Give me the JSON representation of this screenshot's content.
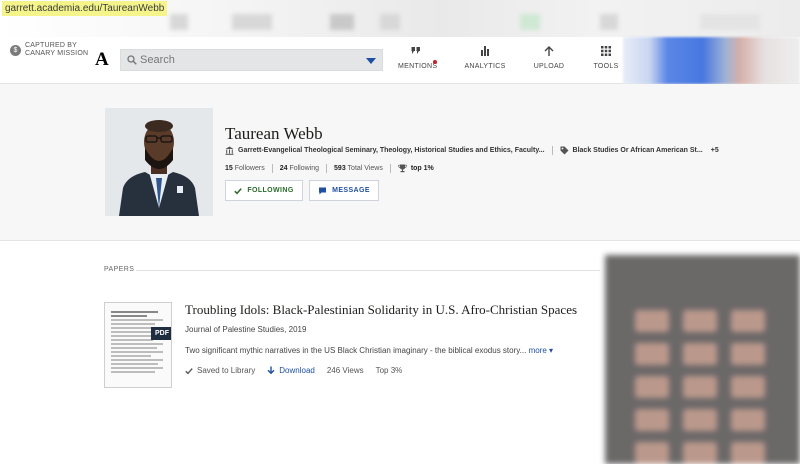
{
  "browser": {
    "url": "garrett.academia.edu/TaureanWebb"
  },
  "canary": {
    "line1": "CAPTURED BY",
    "line2": "CANARY MISSION"
  },
  "logo": {
    "text": "A"
  },
  "search": {
    "placeholder": "Search"
  },
  "nav": [
    {
      "label": "MENTIONS",
      "icon": "quote-icon"
    },
    {
      "label": "ANALYTICS",
      "icon": "bar-chart-icon"
    },
    {
      "label": "UPLOAD",
      "icon": "upload-arrow-icon"
    },
    {
      "label": "TOOLS",
      "icon": "grid-icon"
    }
  ],
  "profile": {
    "name": "Taurean Webb",
    "affiliation": "Garrett-Evangelical Theological Seminary, Theology, Historical Studies and Ethics, Faculty...",
    "interest": "Black Studies Or African American St...",
    "interest_more": "+5",
    "followers_count": "15",
    "followers_label": "Followers",
    "following_count": "24",
    "following_label": "Following",
    "views_count": "593",
    "views_label": "Total Views",
    "top_label": "top 1%",
    "following_button": "FOLLOWING",
    "message_button": "MESSAGE"
  },
  "papers": {
    "section_label": "PAPERS",
    "items": [
      {
        "title": "Troubling Idols: Black-Palestinian Solidarity in U.S. Afro-Christian Spaces",
        "journal": "Journal of Palestine Studies, 2019",
        "abstract": "Two significant mythic narratives in the US Black Christian imaginary - the biblical exodus story...",
        "more_label": "more",
        "badge": "PDF",
        "saved_label": "Saved to Library",
        "download_label": "Download",
        "views": "246 Views",
        "rank": "Top 3%"
      }
    ]
  },
  "colors": {
    "accent": "#1f4fa0",
    "follow_green": "#2a6a2a",
    "mention_dot": "#c7202b"
  }
}
